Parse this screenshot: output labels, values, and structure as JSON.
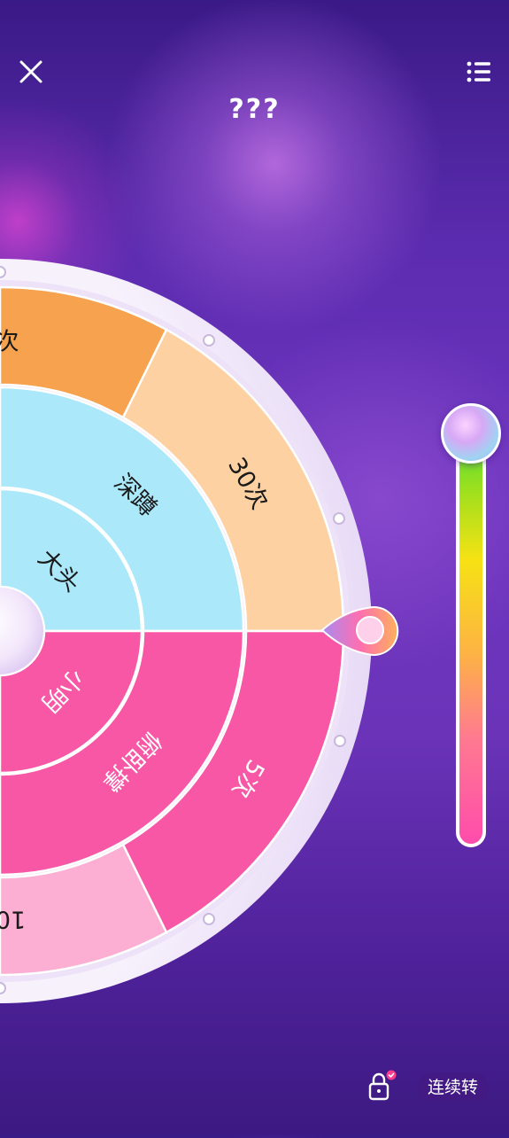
{
  "header": {
    "title": "???",
    "close_icon": "close-icon",
    "menu_icon": "list-menu-icon"
  },
  "wheel": {
    "outer_ring": [
      {
        "label": "次",
        "color": "#f7a24e"
      },
      {
        "label": "30次",
        "color": "#fdd1a2"
      },
      {
        "label": "5次",
        "color": "#f857a6"
      },
      {
        "label": "10",
        "color": "#fcaed3"
      }
    ],
    "middle_ring": [
      {
        "label": "深蹲",
        "color": "#aae8fa"
      },
      {
        "label": "俯卧撑",
        "color": "#f857a6"
      }
    ],
    "inner_ring": [
      {
        "label": "大头",
        "color": "#aae8fa"
      },
      {
        "label": "小明",
        "color": "#f857a6"
      }
    ],
    "pointer_icon": "pointer-icon",
    "rim_color": "#f4ecfb"
  },
  "side_slider": {
    "knob_icon": "slider-knob"
  },
  "footer": {
    "lock_icon": "lock-icon",
    "continuous_label": "连续转"
  }
}
